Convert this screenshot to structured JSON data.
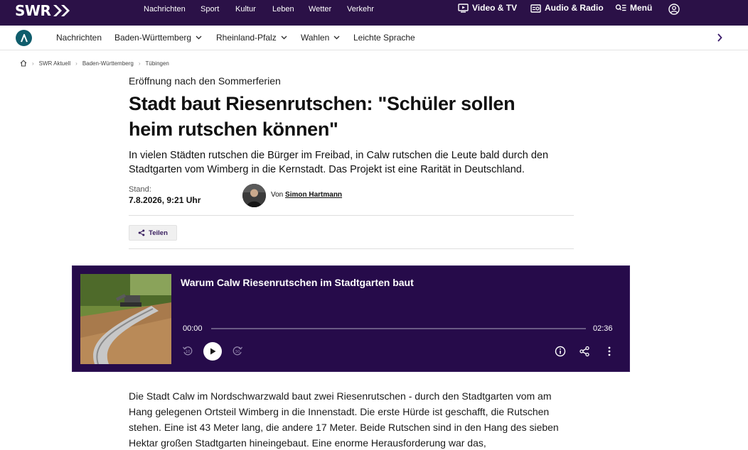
{
  "topbar": {
    "logo_text": "SWR",
    "nav": [
      "Nachrichten",
      "Sport",
      "Kultur",
      "Leben",
      "Wetter",
      "Verkehr"
    ],
    "right": {
      "video": "Video & TV",
      "audio": "Audio & Radio",
      "menu": "Menü"
    }
  },
  "subnav": {
    "items": [
      {
        "label": "Nachrichten",
        "dropdown": false
      },
      {
        "label": "Baden-Württemberg",
        "dropdown": true
      },
      {
        "label": "Rheinland-Pfalz",
        "dropdown": true
      },
      {
        "label": "Wahlen",
        "dropdown": true
      },
      {
        "label": "Leichte Sprache",
        "dropdown": false
      }
    ]
  },
  "breadcrumb": [
    "SWR Aktuell",
    "Baden-Württemberg",
    "Tübingen"
  ],
  "article": {
    "kicker": "Eröffnung nach den Sommerferien",
    "headline_line1": "Stadt baut Riesenrutschen: \"Schüler sollen",
    "headline_line2": "heim rutschen können\"",
    "lead": "In vielen Städten rutschen die Bürger im Freibad, in Calw rutschen die Leute bald durch den Stadtgarten vom Wimberg in die Kernstadt. Das Projekt ist eine Rarität in Deutschland.",
    "stand_label": "Stand:",
    "stand_date": "7.8.2026, 9:21 Uhr",
    "author_prefix": "Von",
    "author_name": "Simon Hartmann",
    "share_label": "Teilen",
    "body": "Die Stadt Calw im Nordschwarzwald baut zwei Riesenrutschen - durch den Stadtgarten vom am Hang gelegenen Ortsteil Wimberg in die Innenstadt. Die erste Hürde ist geschafft, die Rutschen stehen. Eine ist 43 Meter lang, die andere 17 Meter. Beide Rutschen sind in den Hang des sieben Hektar großen Stadtgarten hineingebaut. Eine enorme Herausforderung war das,"
  },
  "player": {
    "title": "Warum Calw Riesenrutschen im Stadtgarten baut",
    "time_current": "00:00",
    "time_total": "02:36",
    "progress": 0,
    "skip_back_seconds": "10",
    "skip_forward_seconds": "30"
  },
  "colors": {
    "topbar_bg": "#2b1147",
    "player_bg": "#260b4a",
    "brand_teal": "#0f5d6c",
    "share_text": "#3a2060"
  }
}
